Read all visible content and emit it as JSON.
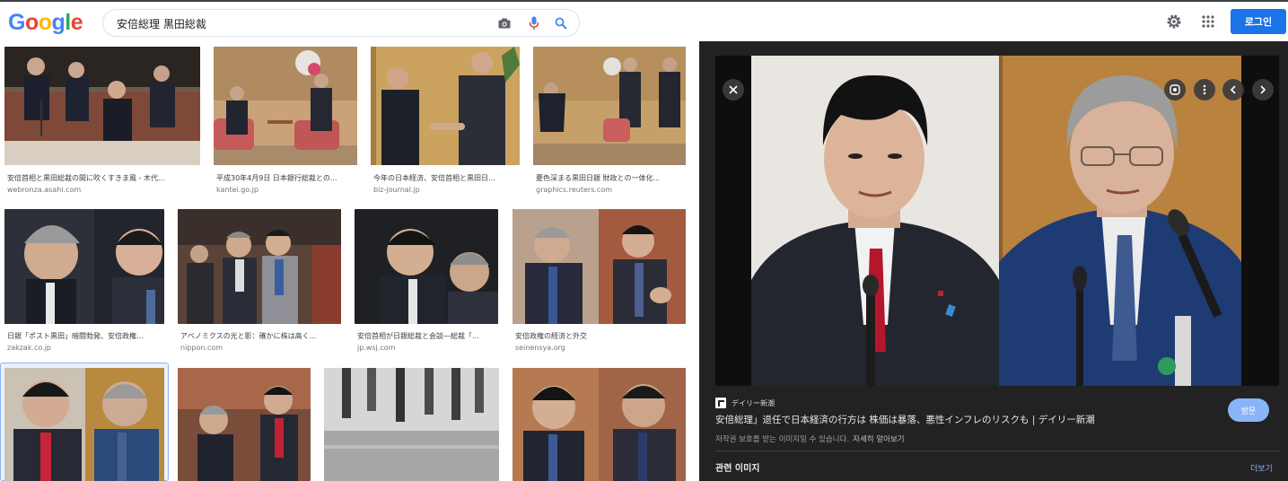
{
  "header": {
    "logo_text": "Google",
    "search_value": "安倍総理 黒田総裁",
    "login_label": "로그인"
  },
  "colors": {
    "google_blue": "#4285F4",
    "google_red": "#EA4335",
    "google_yellow": "#FBBC05",
    "google_green": "#34A853",
    "accent": "#1a73e8",
    "panel_bg": "#222222"
  },
  "icons": {
    "camera": "camera-icon",
    "mic": "mic-icon",
    "search": "search-icon",
    "settings": "gear-icon",
    "apps": "apps-grid-icon",
    "close": "close-icon",
    "lens": "lens-icon",
    "more": "more-vert-icon",
    "prev": "chevron-left-icon",
    "next": "chevron-right-icon"
  },
  "results": [
    {
      "caption": "安倍首相と黒田総裁の間に吹くすきま風 - 木代...",
      "source": "webronza.asahi.com"
    },
    {
      "caption": "平成30年4月9日 日本銀行総裁との...",
      "source": "kantei.go.jp"
    },
    {
      "caption": "今年の日本経済、安倍首相と黒田日...",
      "source": "biz-journal.jp"
    },
    {
      "caption": "憂色深まる黒田日銀 財政との一体化...",
      "source": "graphics.reuters.com"
    },
    {
      "caption": "日銀「ポスト黒田」暗闘勃発、安倍政権...",
      "source": "zakzak.co.jp"
    },
    {
      "caption": "アベノミクスの光と影：確かに株は高く...",
      "source": "nippon.com"
    },
    {
      "caption": "安倍首相が日銀総裁と会談―総裁「...",
      "source": "jp.wsj.com"
    },
    {
      "caption": "安倍政権の経済と外交",
      "source": "seinensya.org"
    },
    {
      "caption": "",
      "source": ""
    },
    {
      "caption": "",
      "source": ""
    },
    {
      "caption": "",
      "source": ""
    },
    {
      "caption": "",
      "source": ""
    }
  ],
  "panel": {
    "site_name": "デイリー新潮",
    "title": "安倍総理」退任で日本経済の行方は 株価は暴落、悪性インフレのリスクも | デイリー新潮",
    "visit_label": "방문",
    "copyright_text": "저작권 보호를 받는 이미지일 수 있습니다.",
    "learn_more": "자세히 알아보기",
    "related_label": "관련 이미지",
    "more_label": "더보기"
  }
}
